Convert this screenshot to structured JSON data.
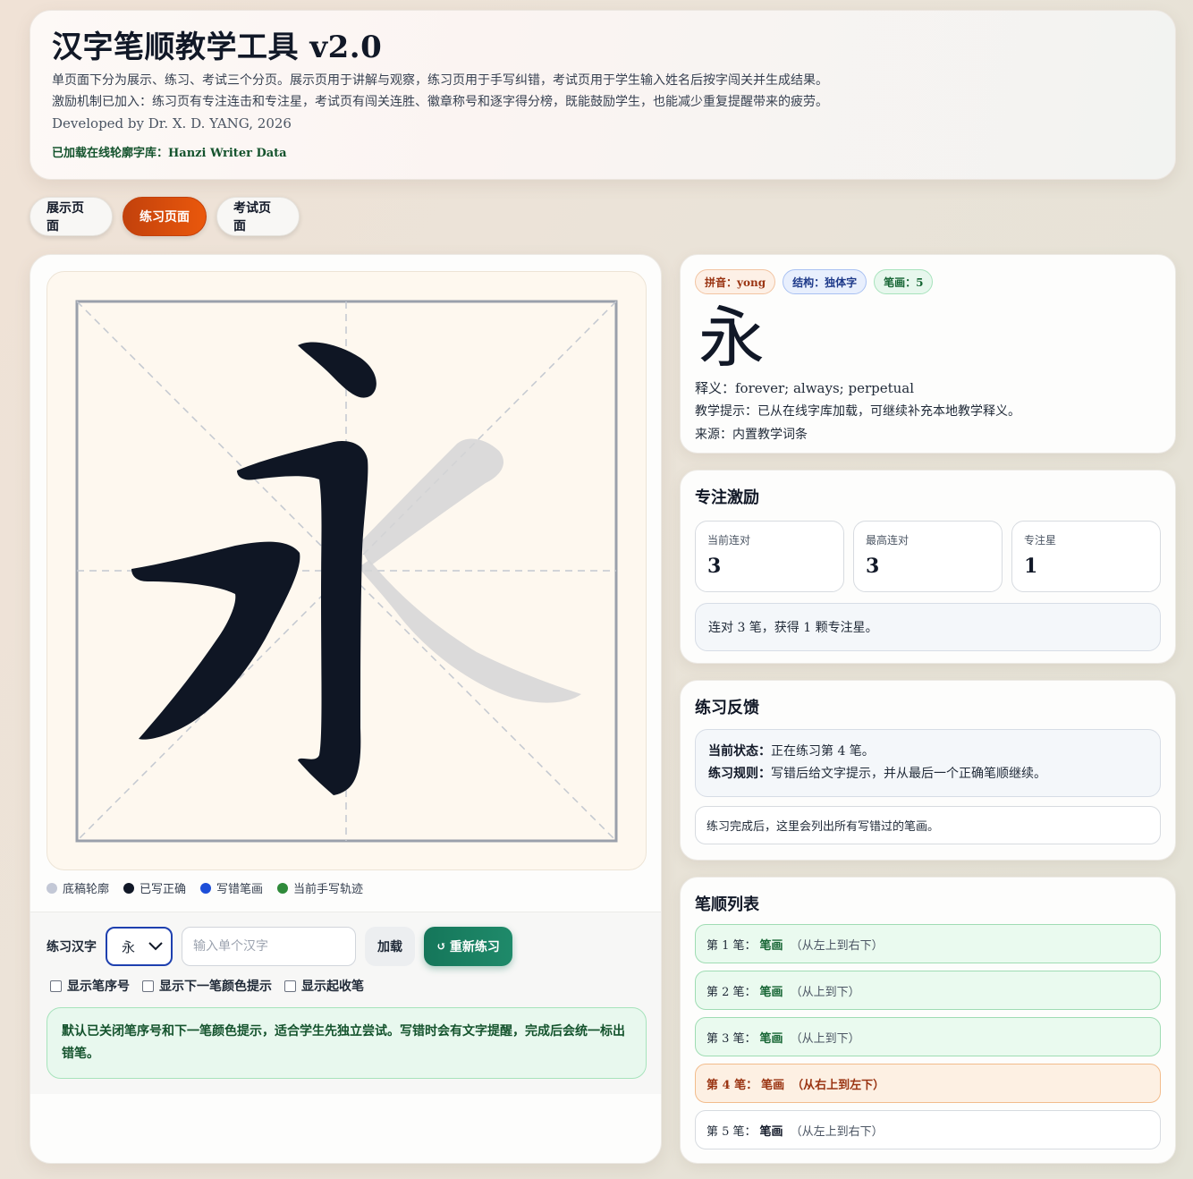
{
  "header": {
    "title": "汉字笔顺教学工具 v2.0",
    "desc1": "单页面下分为展示、练习、考试三个分页。展示页用于讲解与观察，练习页用于手写纠错，考试页用于学生输入姓名后按字闯关并生成结果。",
    "desc2": "激励机制已加入：练习页有专注连击和专注星，考试页有闯关连胜、徽章称号和逐字得分榜，既能鼓励学生，也能减少重复提醒带来的疲劳。",
    "developer": "Developed by Dr. X. D. YANG, 2026",
    "source": "已加载在线轮廓字库：Hanzi Writer Data"
  },
  "tabs": [
    {
      "label": "展示页面",
      "active": false
    },
    {
      "label": "练习页面",
      "active": true
    },
    {
      "label": "考试页面",
      "active": false
    }
  ],
  "legend": {
    "outline": {
      "label": "底稿轮廓",
      "color": "#c3c8d6"
    },
    "correct": {
      "label": "已写正确",
      "color": "#111827"
    },
    "wrong": {
      "label": "写错笔画",
      "color": "#1d4ed8"
    },
    "current": {
      "label": "当前手写轨迹",
      "color": "#2f8a3a"
    }
  },
  "controls": {
    "label": "练习汉字",
    "selected_char": "永",
    "input_placeholder": "输入单个汉字",
    "load_label": "加载",
    "reset_label": "重新练习",
    "options": {
      "show_order": "显示笔序号",
      "show_next": "显示下一笔颜色提示",
      "show_start": "显示起收笔"
    },
    "hint": "默认已关闭笔序号和下一笔颜色提示，适合学生先独立尝试。写错时会有文字提醒，完成后会统一标出错笔。"
  },
  "char_card": {
    "pinyin": "拼音：yong",
    "structure": "结构：独体字",
    "strokes": "笔画：5",
    "char": "永",
    "meaning": "释义：forever; always; perpetual",
    "tip": "教学提示：已从在线字库加载，可继续补充本地教学释义。",
    "source": "来源：内置教学词条"
  },
  "focus": {
    "title": "专注激励",
    "current_label": "当前连对",
    "current_value": "3",
    "best_label": "最高连对",
    "best_value": "3",
    "stars_label": "专注星",
    "stars_value": "1",
    "message": "连对 3 笔，获得 1 颗专注星。"
  },
  "feedback": {
    "title": "练习反馈",
    "status_label": "当前状态：",
    "status_text": "正在练习第 4 笔。",
    "rule_label": "练习规则：",
    "rule_text": "写错后给文字提示，并从最后一个正确笔顺继续。",
    "note": "练习完成后，这里会列出所有写错过的笔画。"
  },
  "stroke_list": {
    "title": "笔顺列表",
    "items": [
      {
        "prefix": "第 1 笔：",
        "name": "笔画",
        "dir": "（从左上到右下）",
        "state": "done"
      },
      {
        "prefix": "第 2 笔：",
        "name": "笔画",
        "dir": "（从上到下）",
        "state": "done"
      },
      {
        "prefix": "第 3 笔：",
        "name": "笔画",
        "dir": "（从上到下）",
        "state": "done"
      },
      {
        "prefix": "第 4 笔：",
        "name": "笔画",
        "dir": "（从右上到左下）",
        "state": "current"
      },
      {
        "prefix": "第 5 笔：",
        "name": "笔画",
        "dir": "（从左上到右下）",
        "state": "pending"
      }
    ]
  }
}
